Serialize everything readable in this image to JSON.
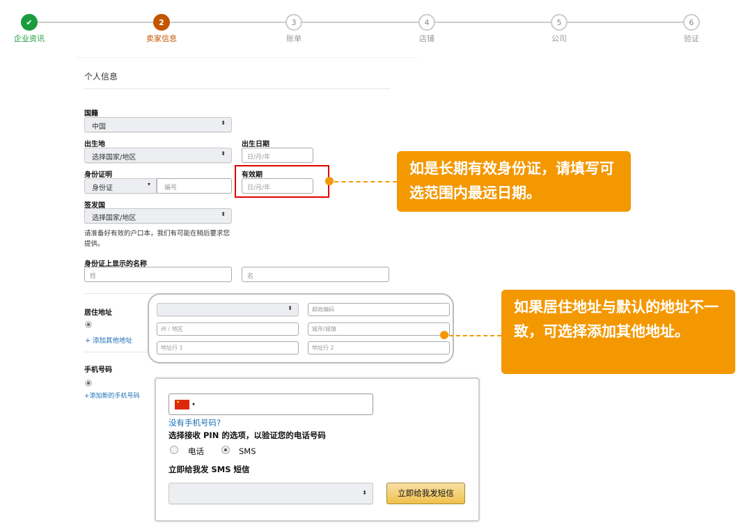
{
  "steps": [
    {
      "num": "✔",
      "label": "企业资讯",
      "state": "done"
    },
    {
      "num": "2",
      "label": "卖家信息",
      "state": "current"
    },
    {
      "num": "3",
      "label": "账单",
      "state": "todo"
    },
    {
      "num": "4",
      "label": "店铺",
      "state": "todo"
    },
    {
      "num": "5",
      "label": "公司",
      "state": "todo"
    },
    {
      "num": "6",
      "label": "验证",
      "state": "todo"
    }
  ],
  "section_title": "个人信息",
  "form": {
    "nationality_label": "国籍",
    "nationality_value": "中国",
    "birthplace_label": "出生地",
    "birthplace_value": "选择国家/地区",
    "dob_label": "出生日期",
    "dob_placeholder": "日/月/年",
    "id_label": "身份证明",
    "id_type": "身份证",
    "id_number_placeholder": "编号",
    "expiry_label": "有效期",
    "expiry_placeholder": "日/月/年",
    "issuer_label": "签发国",
    "issuer_value": "选择国家/地区",
    "note": "请准备好有效的户口本，我们有可能在稍后要求您提供。",
    "name_label": "身份证上显示的名称",
    "last_name_placeholder": "姓",
    "first_name_placeholder": "名",
    "address_label": "居住地址",
    "add_address_link": "+ 添加其他地址",
    "address": {
      "country_value": "",
      "postcode": "邮政编码",
      "state": "州 / 地区",
      "city": "城市/城镇",
      "line1": "地址行 1",
      "line2": "地址行 2"
    },
    "phone_label": "手机号码",
    "add_phone_link": "+添加新的手机号码",
    "phone": {
      "no_phone_link": "没有手机号码?",
      "pin_heading": "选择接收 PIN 的选项，以验证您的电话号码",
      "option_call": "电话",
      "option_sms": "SMS",
      "send_heading": "立即给我发 SMS 短信",
      "send_button": "立即给我发短信"
    }
  },
  "callouts": {
    "expiry": "如是长期有效身份证，请填写可选范围内最远日期。",
    "address": "如果居住地址与默认的地址不一致，可选择添加其他地址。"
  },
  "colors": {
    "accent": "#f39800",
    "done": "#1a9c3e",
    "current": "#c45500",
    "highlight": "#e00000"
  }
}
